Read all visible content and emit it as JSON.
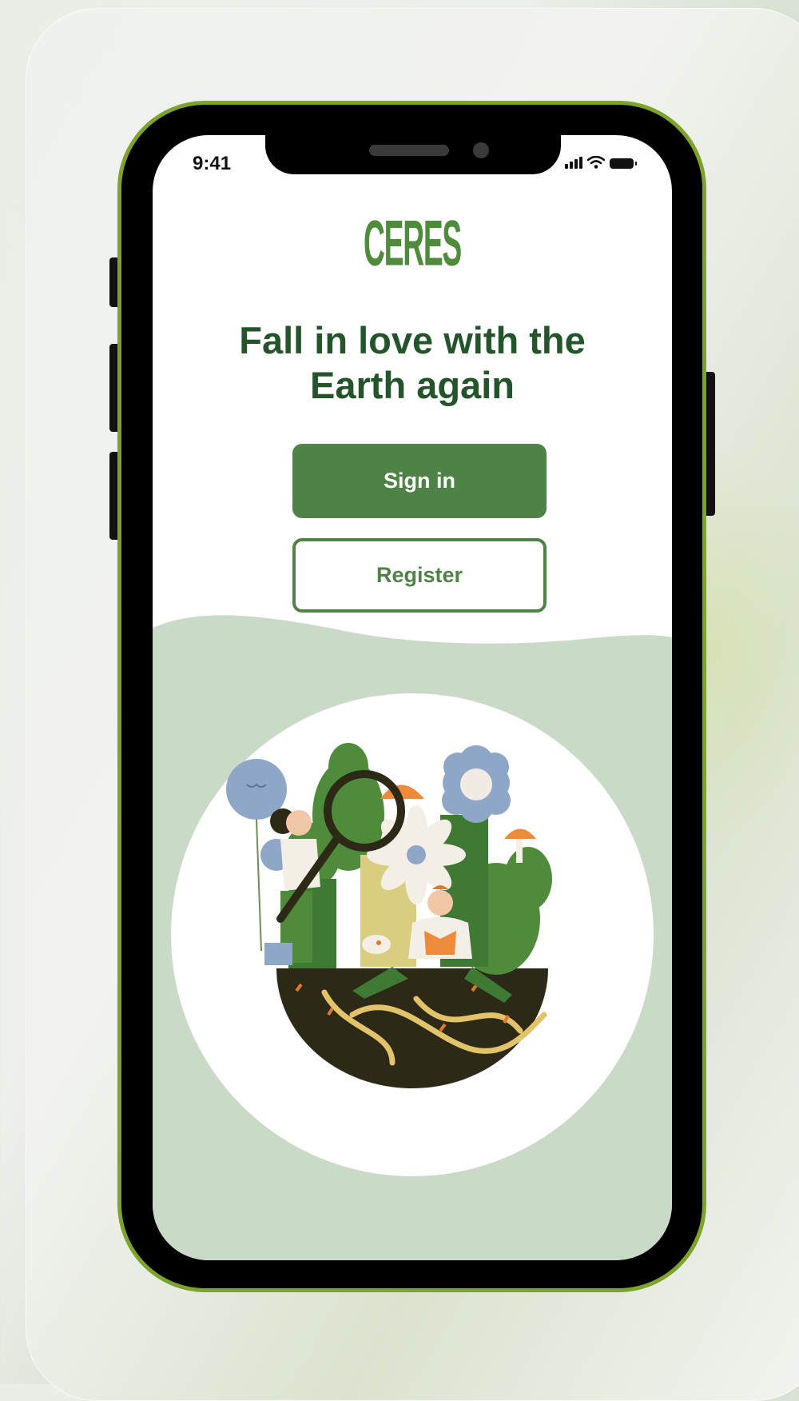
{
  "status_bar": {
    "time": "9:41",
    "icons": [
      "signal-icon",
      "wifi-icon",
      "battery-icon"
    ]
  },
  "app": {
    "logo_text": "CERES"
  },
  "welcome": {
    "headline_line1": "Fall in love with the",
    "headline_line2": "Earth again"
  },
  "actions": {
    "sign_in_label": "Sign in",
    "register_label": "Register"
  },
  "colors": {
    "brand_green": "#4f8246",
    "headline_green": "#24552a",
    "phone_frame": "#7ea32a",
    "illustration_bg": "#c9dac7"
  }
}
